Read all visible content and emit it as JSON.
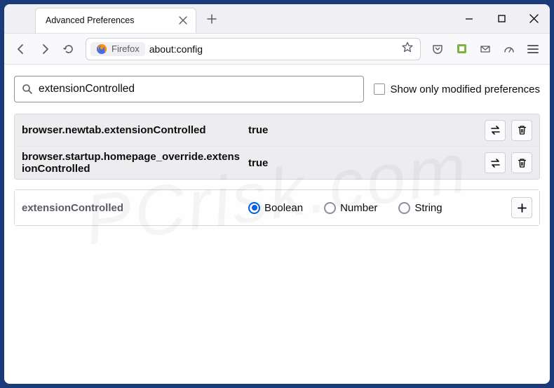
{
  "tab": {
    "title": "Advanced Preferences"
  },
  "urlbar": {
    "identity": "Firefox",
    "url": "about:config"
  },
  "content": {
    "search_value": "extensionControlled",
    "show_modified_label": "Show only modified preferences",
    "prefs": [
      {
        "name": "browser.newtab.extensionControlled",
        "value": "true"
      },
      {
        "name": "browser.startup.homepage_override.extensionControlled",
        "value": "true"
      }
    ],
    "add": {
      "name": "extensionControlled",
      "types": [
        "Boolean",
        "Number",
        "String"
      ],
      "selected": "Boolean"
    }
  },
  "watermark": "PCrisk.com"
}
